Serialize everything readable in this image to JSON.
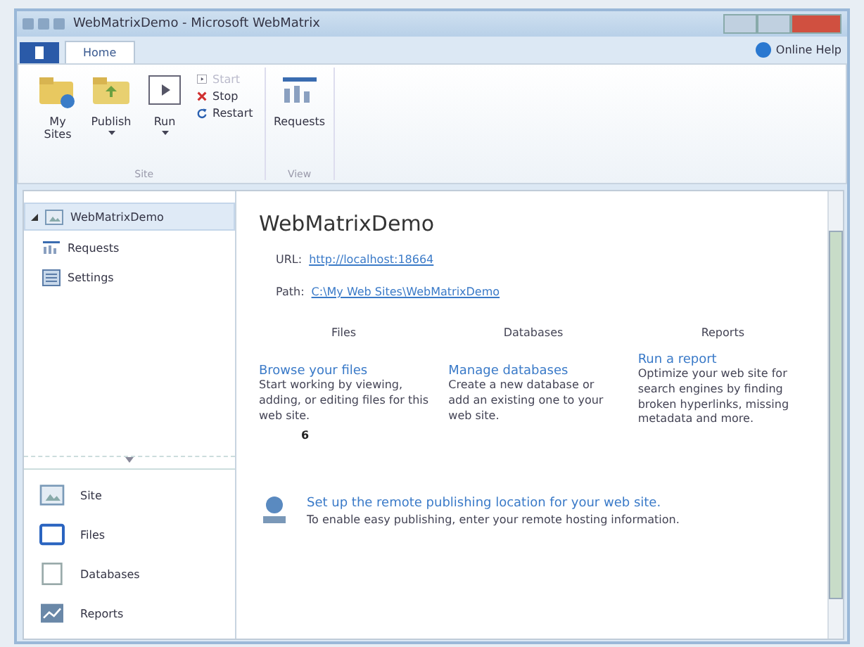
{
  "window": {
    "title": "WebMatrixDemo - Microsoft WebMatrix"
  },
  "ribbon": {
    "tabs": [
      {
        "label": "Home",
        "selected": true
      }
    ],
    "help": "Online Help",
    "groups": [
      {
        "label": "Site",
        "large": [
          {
            "label": "My Sites",
            "dropdown": false
          },
          {
            "label": "Publish",
            "dropdown": true
          },
          {
            "label": "Run",
            "dropdown": true
          }
        ],
        "small": [
          {
            "label": "Start",
            "disabled": true
          },
          {
            "label": "Stop",
            "disabled": false
          },
          {
            "label": "Restart",
            "disabled": false
          }
        ]
      },
      {
        "label": "View",
        "large": [
          {
            "label": "Requests",
            "dropdown": false
          }
        ]
      }
    ]
  },
  "sidebar": {
    "tree": [
      {
        "label": "WebMatrixDemo",
        "selected": true,
        "expanded": true,
        "children": [
          {
            "label": "Requests",
            "selected": false
          },
          {
            "label": "Settings",
            "selected": false
          }
        ]
      }
    ],
    "workspaces": [
      {
        "label": "Site"
      },
      {
        "label": "Files"
      },
      {
        "label": "Databases"
      },
      {
        "label": "Reports"
      }
    ]
  },
  "main": {
    "title": "WebMatrixDemo",
    "fields": [
      {
        "label": "URL:",
        "value": "http://localhost:18664"
      },
      {
        "label": "Path:",
        "value": "C:\\My Web Sites\\WebMatrixDemo"
      }
    ],
    "columns": [
      {
        "heading": "Files",
        "link": "Browse your files",
        "text": "Start working by viewing, adding, or editing files for this web site."
      },
      {
        "heading": "Databases",
        "link": "Manage databases",
        "text": "Create a new database or add an existing one to your web site."
      },
      {
        "heading": "Reports",
        "link": "Run a report",
        "text": "Optimize your web site for search engines by finding broken hyperlinks, missing metadata and more."
      }
    ],
    "callout": "6",
    "publish": {
      "link": "Set up the remote publishing location for your web site.",
      "text": "To enable easy publishing, enter your remote hosting information."
    }
  }
}
